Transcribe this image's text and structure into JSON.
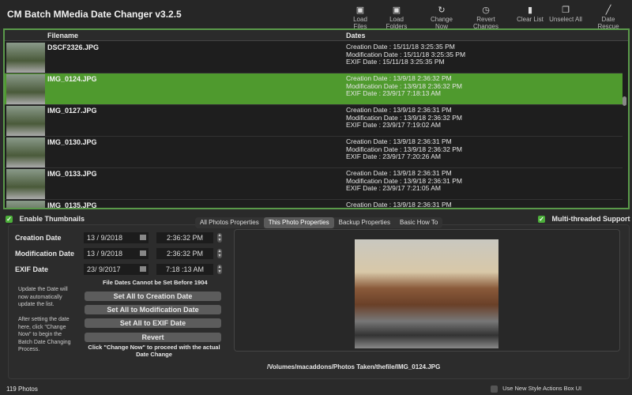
{
  "app": {
    "title": "CM Batch MMedia Date Changer v3.2.5"
  },
  "toolbar": [
    {
      "label": "Load Files",
      "icon": "image-icon"
    },
    {
      "label": "Load Folders",
      "icon": "folder-image-icon"
    },
    {
      "label": "Change Now",
      "icon": "refresh-icon"
    },
    {
      "label": "Revert Changes",
      "icon": "clock-icon"
    },
    {
      "label": "Clear List",
      "icon": "document-icon"
    },
    {
      "label": "Unselect All",
      "icon": "copy-icon"
    },
    {
      "label": "Date Rescue",
      "icon": "brush-icon"
    }
  ],
  "list": {
    "columns": [
      "Filename",
      "Dates"
    ],
    "rows": [
      {
        "file": "DSCF2326.JPG",
        "dates": [
          "Creation Date : 15/11/18 3:25:35 PM",
          "Modification Date : 15/11/18 3:25:35 PM",
          "EXIF Date : 15/11/18 3:25:35 PM"
        ],
        "selected": false
      },
      {
        "file": "IMG_0124.JPG",
        "dates": [
          "Creation Date : 13/9/18 2:36:32 PM",
          "Modification Date : 13/9/18 2:36:32 PM",
          "EXIF Date : 23/9/17 7:18:13 AM"
        ],
        "selected": true
      },
      {
        "file": "IMG_0127.JPG",
        "dates": [
          "Creation Date : 13/9/18 2:36:31 PM",
          "Modification Date : 13/9/18 2:36:32 PM",
          "EXIF Date : 23/9/17 7:19:02 AM"
        ],
        "selected": false
      },
      {
        "file": "IMG_0130.JPG",
        "dates": [
          "Creation Date : 13/9/18 2:36:31 PM",
          "Modification Date : 13/9/18 2:36:32 PM",
          "EXIF Date : 23/9/17 7:20:26 AM"
        ],
        "selected": false
      },
      {
        "file": "IMG_0133.JPG",
        "dates": [
          "Creation Date : 13/9/18 2:36:31 PM",
          "Modification Date : 13/9/18 2:36:31 PM",
          "EXIF Date : 23/9/17 7:21:05 AM"
        ],
        "selected": false
      },
      {
        "file": "IMG_0135.JPG",
        "dates": [
          "Creation Date : 13/9/18 2:36:31 PM",
          "",
          ""
        ],
        "selected": false
      }
    ]
  },
  "options": {
    "thumbnails": "Enable Thumbnails",
    "thumbnails_checked": true,
    "multithread": "Multi-threaded Support",
    "multithread_checked": true,
    "new_ui": "Use New Style Actions Box UI",
    "new_ui_checked": false
  },
  "tabs": [
    {
      "label": "All Photos Properties"
    },
    {
      "label": "This Photo Properties",
      "active": true
    },
    {
      "label": "Backup Properties"
    },
    {
      "label": "Basic How To"
    }
  ],
  "fields": [
    {
      "label": "Creation Date",
      "date": "13 /  9/2018",
      "time": "2:36:32  PM"
    },
    {
      "label": "Modification Date",
      "date": "13 /  9/2018",
      "time": "2:36:32  PM"
    },
    {
      "label": "EXIF Date",
      "date": "23/  9/2017",
      "time": "7:18 :13  AM"
    }
  ],
  "warning": "File Dates Cannot be Set Before 1904",
  "notes": {
    "note1": "Update the Date will now automatically update the list.",
    "note2": "After setting the date here,  click \"Change Now\" to begin the Batch Date Changing Process."
  },
  "buttons": {
    "set_creation": "Set All to Creation Date",
    "set_modification": "Set All to Modification Date",
    "set_exif": "Set All to EXIF Date",
    "revert": "Revert"
  },
  "hint": "Click \"Change Now\" to proceed with the actual Date Change",
  "preview": {
    "path": "/Volumes/macaddons/Photos Taken/thefile/IMG_0124.JPG"
  },
  "status": {
    "count": "119 Photos"
  },
  "colors": {
    "accent": "#4f9a2e",
    "checkbox": "#4caf3a"
  }
}
